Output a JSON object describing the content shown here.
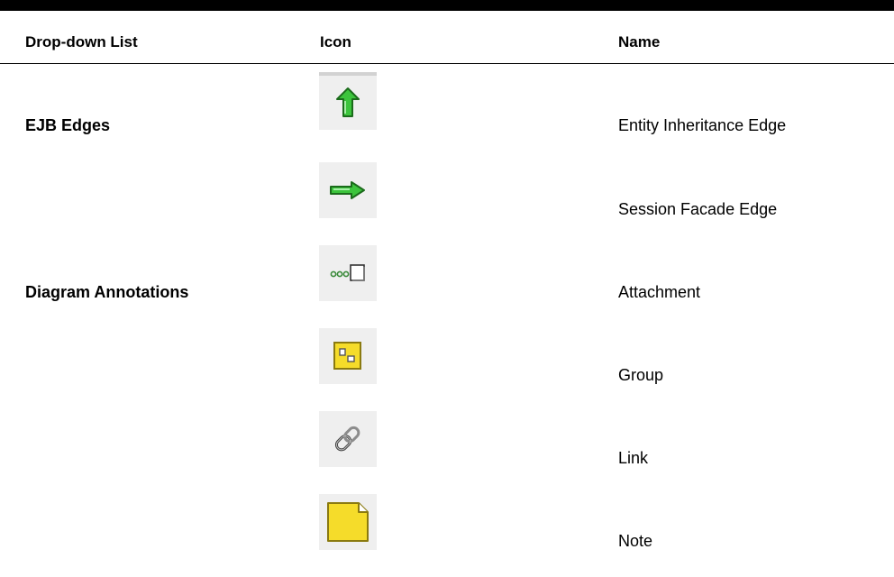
{
  "table": {
    "headers": {
      "dropdown": "Drop-down List",
      "icon": "Icon",
      "name": "Name"
    },
    "categories": [
      "EJB Edges",
      "Diagram Annotations"
    ],
    "rows": [
      {
        "icon": "up-arrow-green-icon",
        "name": "Entity Inheritance Edge"
      },
      {
        "icon": "right-arrow-green-icon",
        "name": "Session Facade Edge"
      },
      {
        "icon": "attachment-icon",
        "name": "Attachment"
      },
      {
        "icon": "group-icon",
        "name": "Group"
      },
      {
        "icon": "link-chain-icon",
        "name": "Link"
      },
      {
        "icon": "note-icon",
        "name": "Note"
      }
    ]
  },
  "colors": {
    "icon_green": "#3cc43c",
    "icon_yellow": "#f5dc2a",
    "cell_bg": "#efefef"
  }
}
